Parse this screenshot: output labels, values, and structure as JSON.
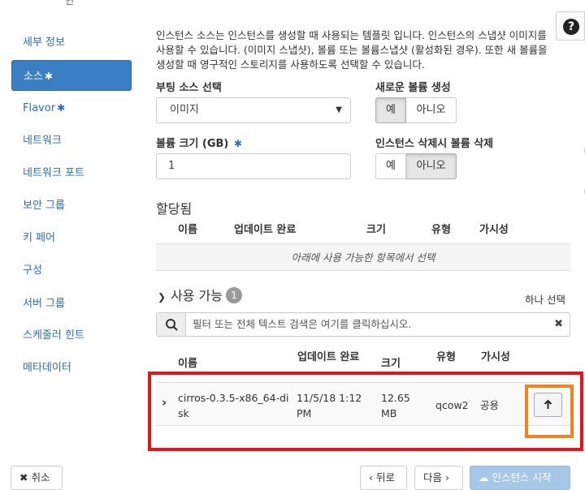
{
  "header_fragment": "인",
  "sidebar": {
    "items": [
      {
        "label": "세부 정보",
        "required": false
      },
      {
        "label": "소스",
        "required": true
      },
      {
        "label": "Flavor",
        "required": true
      },
      {
        "label": "네트워크",
        "required": false
      },
      {
        "label": "네트워크 포트",
        "required": false
      },
      {
        "label": "보안 그룹",
        "required": false
      },
      {
        "label": "키 페어",
        "required": false
      },
      {
        "label": "구성",
        "required": false
      },
      {
        "label": "서버 그룹",
        "required": false
      },
      {
        "label": "스케줄러 힌트",
        "required": false
      },
      {
        "label": "메타데이터",
        "required": false
      }
    ],
    "required_mark": "✱"
  },
  "help_label": "?",
  "description": "인스턴스 소스는 인스턴스를 생성할 때 사용되는 템플릿 입니다. 인스턴스의 스냅샷 이미지를 사용할 수 있습니다. (이미지 스냅샷), 볼륨 또는 볼륨스냅샷 (활성화된 경우). 또한 새 볼륨을 생성할 때 영구적인 스토리지를 사용하도록 선택할 수 있습니다.",
  "form": {
    "boot_source_label": "부팅 소스 선택",
    "boot_source_value": "이미지",
    "new_volume_label": "새로운 볼륨 생성",
    "new_volume_yes": "예",
    "new_volume_no": "아니오",
    "volume_size_label": "볼륨 크기 (GB)",
    "volume_size_value": "1",
    "delete_volume_label": "인스턴스 삭제시 볼륨 삭제",
    "delete_yes": "예",
    "delete_no": "아니오"
  },
  "allocated": {
    "title": "할당됨",
    "columns": [
      "이름",
      "업데이트 완료",
      "크기",
      "유형",
      "가시성"
    ],
    "empty_text": "아래에 사용 가능한 항목에서 선택"
  },
  "available": {
    "title": "사용 가능",
    "count": "1",
    "pick_one": "하나 선택",
    "filter_placeholder": "필터 또는 전체 텍스트 검색은 여기를 클릭하십시오.",
    "clear_icon": "✖",
    "columns": [
      "이름",
      "업데이트 완료",
      "크기",
      "유형",
      "가시성"
    ],
    "row": {
      "name_line1": "cirros-0.3.5-x86_64-di",
      "name_line2": "sk",
      "updated_line1": "11/5/18 1:12",
      "updated_line2": "PM",
      "size_line1": "12.65",
      "size_line2": "MB",
      "type": "qcow2",
      "visibility": "공용"
    }
  },
  "footer": {
    "cancel": "✖ 취소",
    "back": "‹ 뒤로",
    "next": "다음 ›",
    "launch": "인스턴스 시작"
  },
  "colors": {
    "active_bg": "#3a7ec4",
    "link": "#2a6ebb",
    "highlight_red": "#e0161c",
    "highlight_orange": "#f5821f"
  }
}
